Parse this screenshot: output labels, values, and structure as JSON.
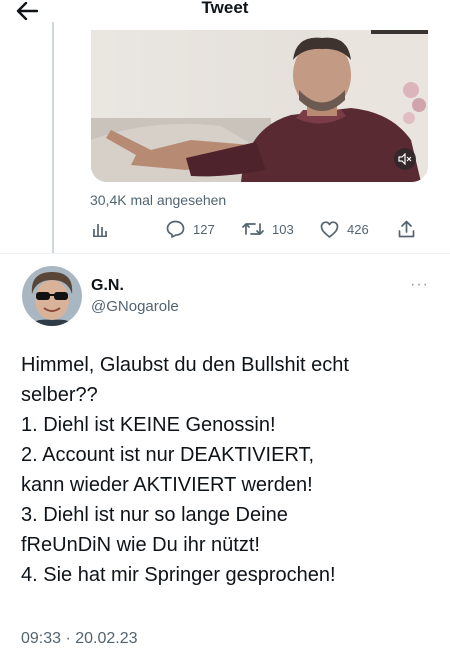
{
  "header": {
    "title": "Tweet",
    "back_icon": "arrow-left-icon"
  },
  "previous_tweet": {
    "views": "30,4K mal angesehen",
    "actions": {
      "analytics_icon": "bar-chart-icon",
      "replies": "127",
      "retweets": "103",
      "likes": "426",
      "share_icon": "share-icon"
    }
  },
  "tweet": {
    "name": "G.N.",
    "handle": "@GNogarole",
    "more": "···",
    "lines": [
      "Himmel, Glaubst du den Bullshit echt",
      "selber??",
      "1. Diehl ist KEINE Genossin!",
      "2. Account ist nur DEAKTIVIERT,",
      "kann wieder AKTIVIERT werden!",
      "3. Diehl ist nur so lange Deine",
      "fReUnDiN wie Du ihr nützt!",
      "4. Sie hat mir Springer gesprochen!"
    ],
    "timestamp": "09:33 · 20.02.23"
  },
  "colors": {
    "text": "#0f1419",
    "secondary": "#536471",
    "divider": "#eff3f4",
    "thread_line": "#cfd9de"
  }
}
